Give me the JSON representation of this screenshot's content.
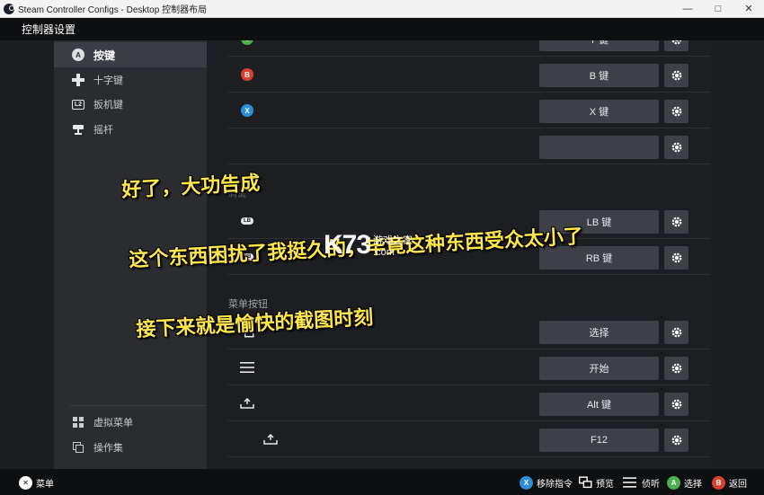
{
  "window": {
    "title": "Steam Controller Configs - Desktop 控制器布局",
    "minimize": "—",
    "maximize": "□",
    "close": "✕"
  },
  "header": {
    "title": "控制器设置"
  },
  "sidebar": {
    "items": [
      {
        "label": "按键",
        "icon": "a-button-icon",
        "active": true
      },
      {
        "label": "十字键",
        "icon": "dpad-icon",
        "active": false
      },
      {
        "label": "扳机键",
        "icon": "l2-trigger-icon",
        "active": false
      },
      {
        "label": "摇杆",
        "icon": "joystick-icon",
        "active": false
      }
    ],
    "bottom_items": [
      {
        "label": "虚拟菜单",
        "icon": "grid-menu-icon"
      },
      {
        "label": "操作集",
        "icon": "action-set-icon"
      }
    ],
    "a_glyph": "A",
    "l2_glyph": "L2"
  },
  "buttons": {
    "rows": [
      {
        "glyph": "Y",
        "color": "#4caf50",
        "value": "Y 键"
      },
      {
        "glyph": "B",
        "color": "#d9412e",
        "value": "B 键"
      },
      {
        "glyph": "X",
        "color": "#2e8ed9",
        "value": "X 键"
      },
      {
        "glyph": "",
        "color": "",
        "value": ""
      }
    ],
    "bumper_section_label": "肩键",
    "bumper_rows": [
      {
        "glyph": "LB",
        "value": "LB 键"
      },
      {
        "glyph": "RB",
        "value": "RB 键"
      }
    ]
  },
  "menu_section": {
    "label": "菜单按钮",
    "rows": [
      {
        "icon": "view-icon",
        "value": "选择"
      },
      {
        "icon": "hamburger-icon",
        "value": "开始"
      },
      {
        "icon": "upload-icon",
        "value": "Alt 键"
      },
      {
        "icon": "upload-icon",
        "value": "F12",
        "indented": true
      }
    ]
  },
  "bottombar": {
    "menu_label": "菜单",
    "hints": [
      {
        "glyph": "X",
        "color": "#2e8ed9",
        "label": "移除指令"
      },
      {
        "glyph": "",
        "color": "",
        "label": "预览"
      },
      {
        "glyph": "",
        "color": "",
        "label": "侦听"
      },
      {
        "glyph": "A",
        "color": "#4caf50",
        "label": "选择"
      },
      {
        "glyph": "B",
        "color": "#d9412e",
        "label": "返回"
      }
    ]
  },
  "overlay": {
    "caption_lines": [
      "好了，大功告成",
      "这个东西困扰了我挺久的，毕竟这种东西受众太小了",
      "接下来就是愉快的截图时刻"
    ],
    "watermark_big": "K73",
    "watermark_cn": "游戏之家",
    "watermark_domain": ".com"
  }
}
